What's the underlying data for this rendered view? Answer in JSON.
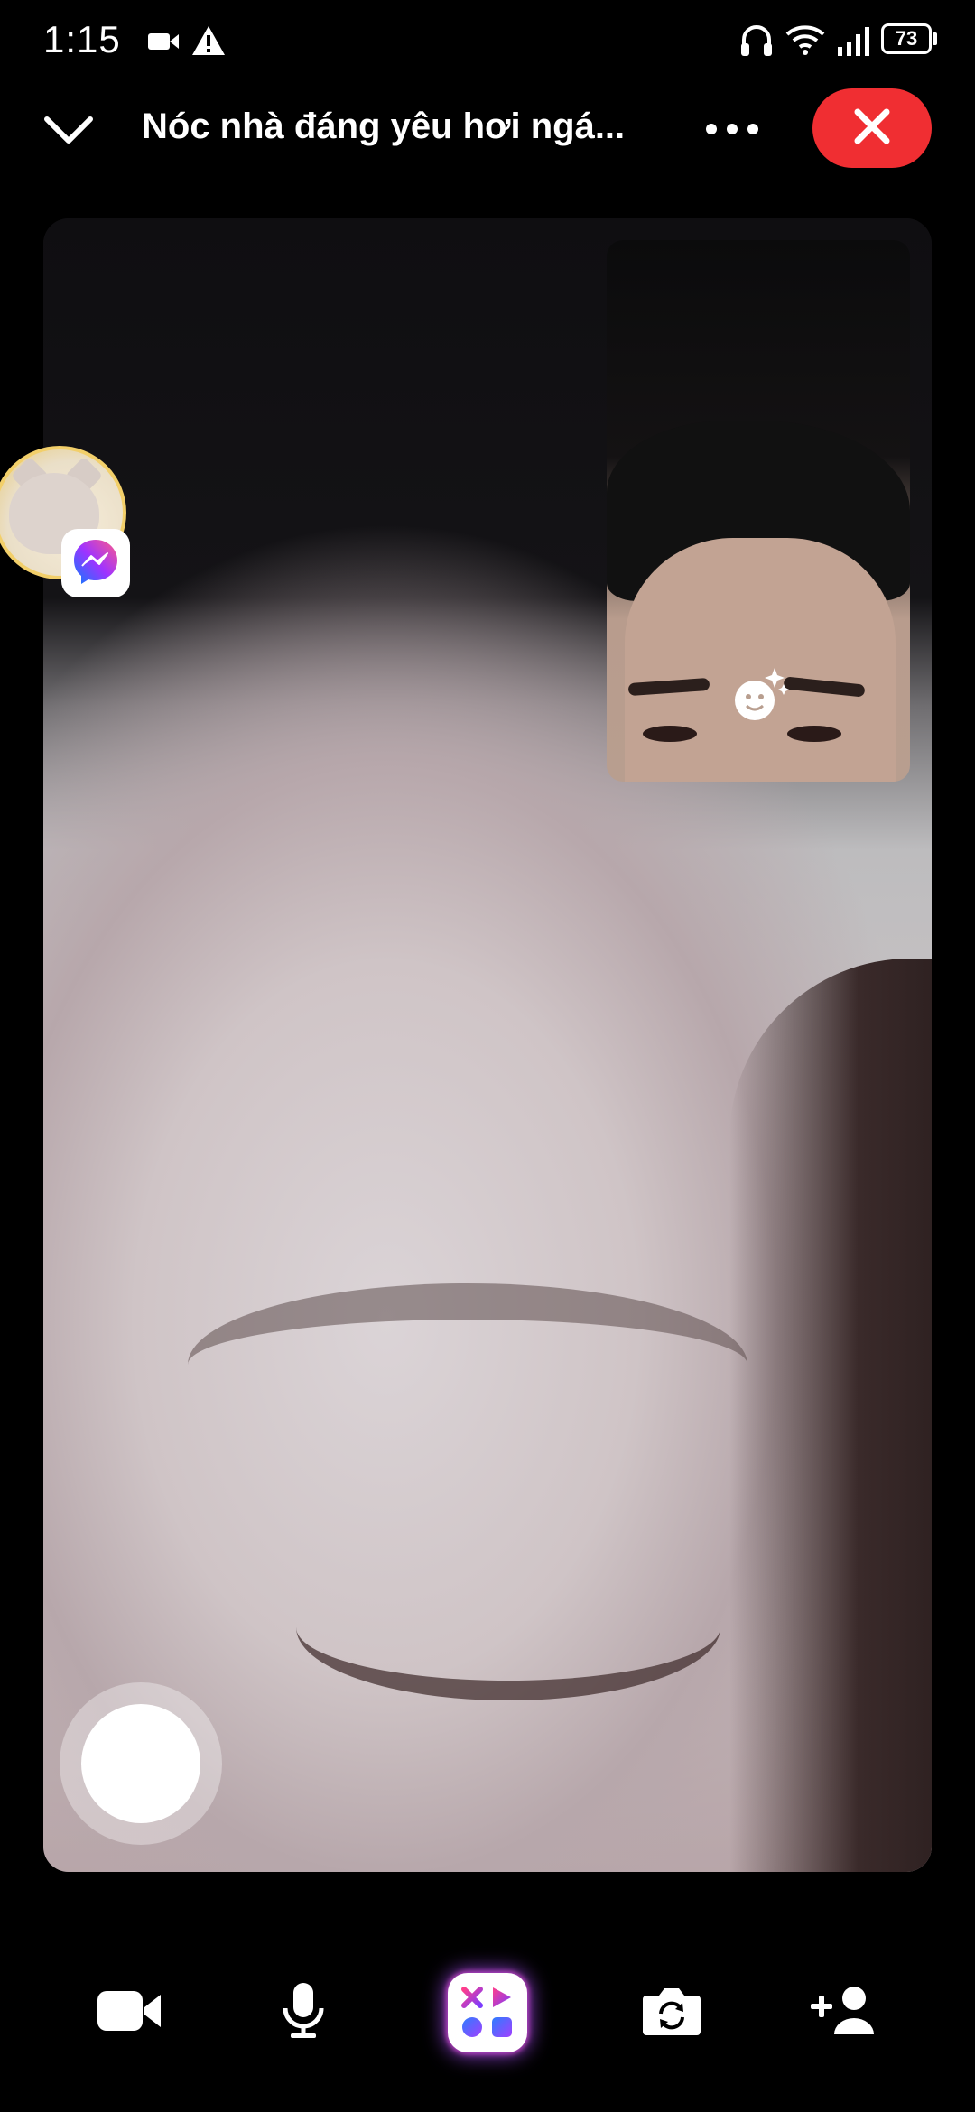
{
  "status_bar": {
    "time": "1:15",
    "battery_level": "73",
    "icons": [
      "video-camera-icon",
      "warning-icon",
      "headphones-icon",
      "wifi-icon",
      "signal-icon",
      "battery-icon"
    ]
  },
  "call_header": {
    "title": "Nóc nhà đáng yêu hơi ngá...",
    "collapse_icon": "chevron-down-icon",
    "more_icon": "more-horizontal-icon",
    "end_call_icon": "close-icon",
    "end_call_color": "#f02e32"
  },
  "main_video": {
    "self_view_effects_icon": "sparkle-face-icon"
  },
  "chat_head": {
    "badge_icon": "messenger-icon"
  },
  "shutter": {
    "icon": "capture-icon"
  },
  "controls": [
    {
      "name": "camera-toggle",
      "icon": "video-camera-icon"
    },
    {
      "name": "microphone-toggle",
      "icon": "microphone-icon"
    },
    {
      "name": "apps",
      "icon": "apps-icon"
    },
    {
      "name": "flip-camera",
      "icon": "flip-camera-icon"
    },
    {
      "name": "add-person",
      "icon": "add-person-icon"
    }
  ],
  "colors": {
    "background": "#000000",
    "end_call": "#f02e32",
    "apps_glow": "#aa50ff"
  }
}
